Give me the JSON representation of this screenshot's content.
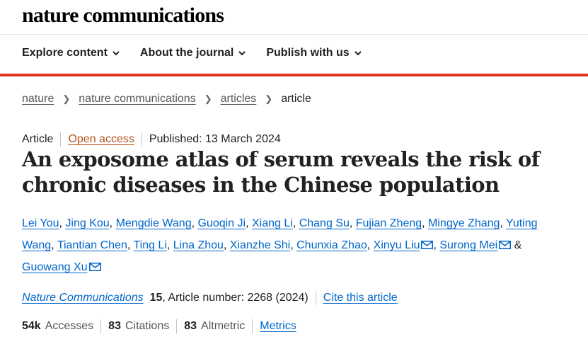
{
  "site": {
    "logo": "nature communications"
  },
  "nav": {
    "items": [
      "Explore content",
      "About the journal",
      "Publish with us"
    ]
  },
  "colors": {
    "accent_red": "#e0311f",
    "link_blue": "#0066cc",
    "open_access": "#b8541e"
  },
  "breadcrumb": {
    "items": [
      "nature",
      "nature communications",
      "articles"
    ],
    "current": "article"
  },
  "article": {
    "type": "Article",
    "access": "Open access",
    "published": "Published: 13 March 2024",
    "title": "An exposome atlas of serum reveals the risk of chronic diseases in the Chinese population",
    "authors": [
      {
        "name": "Lei You",
        "email": false
      },
      {
        "name": "Jing Kou",
        "email": false
      },
      {
        "name": "Mengdie Wang",
        "email": false
      },
      {
        "name": "Guoqin Ji",
        "email": false
      },
      {
        "name": "Xiang Li",
        "email": false
      },
      {
        "name": "Chang Su",
        "email": false
      },
      {
        "name": "Fujian Zheng",
        "email": false
      },
      {
        "name": "Mingye Zhang",
        "email": false
      },
      {
        "name": "Yuting Wang",
        "email": false
      },
      {
        "name": "Tiantian Chen",
        "email": false
      },
      {
        "name": "Ting Li",
        "email": false
      },
      {
        "name": "Lina Zhou",
        "email": false
      },
      {
        "name": "Xianzhe Shi",
        "email": false
      },
      {
        "name": "Chunxia Zhao",
        "email": false
      },
      {
        "name": "Xinyu Liu",
        "email": true
      },
      {
        "name": "Surong Mei",
        "email": true
      },
      {
        "name": "Guowang Xu",
        "email": true
      }
    ],
    "author_last_joiner": "&",
    "citation": {
      "journal": "Nature Communications",
      "volume": "15",
      "article_number": ", Article number: 2268 (2024)",
      "cite_label": "Cite this article"
    },
    "metrics": {
      "accesses_value": "54k",
      "accesses_label": "Accesses",
      "citations_value": "83",
      "citations_label": "Citations",
      "altmetric_value": "83",
      "altmetric_label": "Altmetric",
      "metrics_link": "Metrics"
    }
  }
}
